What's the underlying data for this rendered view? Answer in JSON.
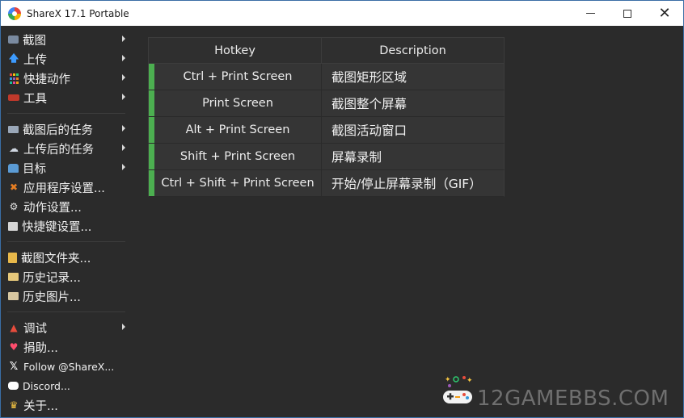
{
  "window": {
    "title": "ShareX 17.1 Portable",
    "controls": {
      "minimize": "minimize",
      "maximize": "maximize",
      "close": "✕"
    }
  },
  "menu": {
    "items": [
      {
        "label": "截图",
        "icon": "capture-icon",
        "submenu": true
      },
      {
        "label": "上传",
        "icon": "upload-icon",
        "submenu": true
      },
      {
        "label": "快捷动作",
        "icon": "grid-icon",
        "submenu": true
      },
      {
        "label": "工具",
        "icon": "tools-icon",
        "submenu": true
      },
      {
        "label": "截图后的任务",
        "icon": "after-capture-icon",
        "submenu": true
      },
      {
        "label": "上传后的任务",
        "icon": "after-upload-icon",
        "submenu": true
      },
      {
        "label": "目标",
        "icon": "destination-icon",
        "submenu": true
      },
      {
        "label": "应用程序设置...",
        "icon": "wrench-icon",
        "submenu": false
      },
      {
        "label": "动作设置...",
        "icon": "gear-icon",
        "submenu": false
      },
      {
        "label": "快捷键设置...",
        "icon": "keyboard-icon",
        "submenu": false
      },
      {
        "label": "截图文件夹...",
        "icon": "folder-icon",
        "submenu": false
      },
      {
        "label": "历史记录...",
        "icon": "history-icon",
        "submenu": false
      },
      {
        "label": "历史图片...",
        "icon": "image-history-icon",
        "submenu": false
      },
      {
        "label": "调试",
        "icon": "debug-icon",
        "submenu": true
      },
      {
        "label": "捐助...",
        "icon": "heart-icon",
        "submenu": false
      },
      {
        "label": "Follow @ShareX...",
        "icon": "x-logo-icon",
        "submenu": false
      },
      {
        "label": "Discord...",
        "icon": "discord-icon",
        "submenu": false
      },
      {
        "label": "关于...",
        "icon": "crown-icon",
        "submenu": false
      }
    ]
  },
  "hotkeys": {
    "headers": {
      "hotkey": "Hotkey",
      "description": "Description"
    },
    "rows": [
      {
        "keys": "Ctrl + Print Screen",
        "description": "截图矩形区域",
        "status_color": "#4caf50"
      },
      {
        "keys": "Print Screen",
        "description": "截图整个屏幕",
        "status_color": "#4caf50"
      },
      {
        "keys": "Alt + Print Screen",
        "description": "截图活动窗口",
        "status_color": "#4caf50"
      },
      {
        "keys": "Shift + Print Screen",
        "description": "屏幕录制",
        "status_color": "#4caf50"
      },
      {
        "keys": "Ctrl + Shift + Print Screen",
        "description": "开始/停止屏幕录制（GIF）",
        "status_color": "#4caf50"
      }
    ]
  },
  "watermark": {
    "text": "12GAMEBBS.COM",
    "icon": "gamepad-icon"
  },
  "colors": {
    "background": "#2b2b2b",
    "table_row": "#353535",
    "status_ok": "#4caf50",
    "titlebar": "#ffffff"
  }
}
